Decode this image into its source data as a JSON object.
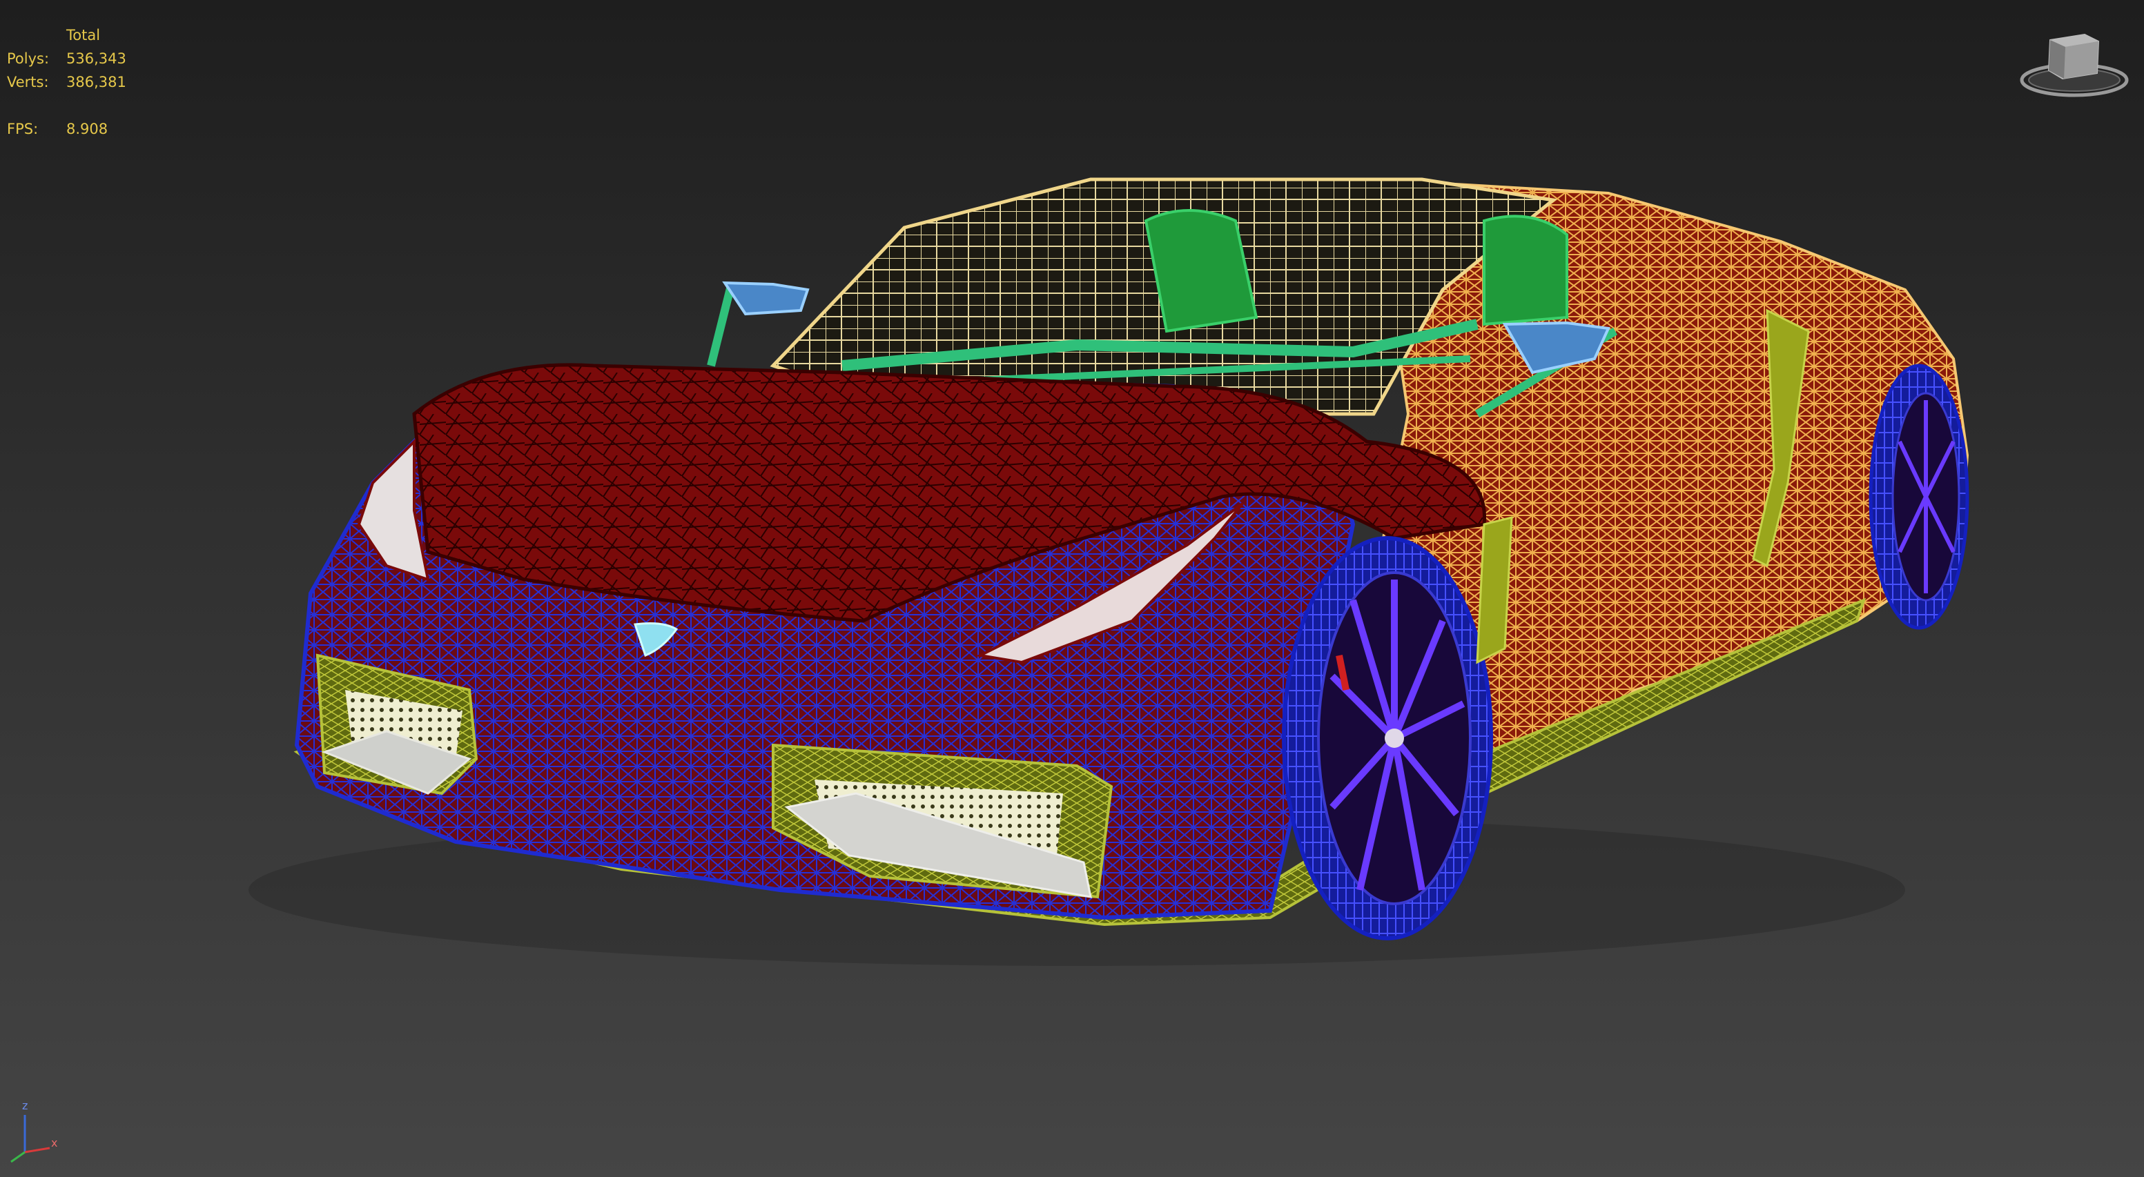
{
  "statistics": {
    "header": "Total",
    "polys_label": "Polys:",
    "polys_value": "536,343",
    "verts_label": "Verts:",
    "verts_value": "386,381",
    "fps_label": "FPS:",
    "fps_value": "8.908"
  },
  "viewcube": {
    "icon": "viewcube-icon"
  },
  "axis_tripod": {
    "icon": "axis-tripod-icon",
    "z": "z",
    "x": "x"
  },
  "colors": {
    "body_red": "#7a0a0a",
    "wire_blue": "#1f2bd0",
    "wire_orange": "#f0b04e",
    "wire_green": "#2fc07a",
    "wire_yellowgreen": "#9aa61c",
    "glass_wire": "#e8d9a0",
    "stats_text": "#e6c84a"
  }
}
